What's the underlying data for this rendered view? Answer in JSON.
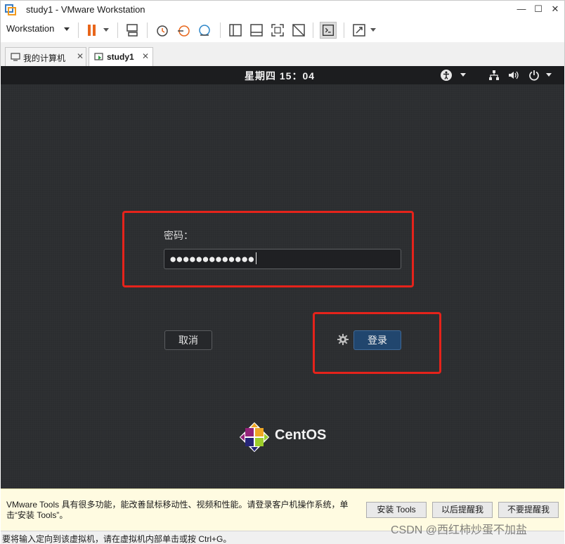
{
  "window": {
    "title": "study1 - VMware Workstation",
    "minimize_glyph": "—",
    "maximize_glyph": "☐",
    "close_glyph": "✕"
  },
  "toolbar": {
    "workstation_menu": "Workstation",
    "icons": [
      "pause-icon",
      "send-ctrl-alt-del-icon",
      "snapshot-icon",
      "revert-snapshot-icon",
      "snapshot-manager-icon",
      "show-library-icon",
      "thumbnail-bar-icon",
      "full-screen-icon",
      "unity-icon",
      "console-view-icon",
      "stretch-guest-icon"
    ]
  },
  "tabs": [
    {
      "label": "我的计算机",
      "active": false
    },
    {
      "label": "study1",
      "active": true
    }
  ],
  "tab_close_glyph": "✕",
  "vm": {
    "clock": "星期四 15：04",
    "password_label": "密码：",
    "password_value": "●●●●●●●●●●●●●",
    "cancel_button": "取消",
    "login_button": "登录",
    "brand": "CentOS",
    "colors": {
      "login_button": "#21466e",
      "highlight_box": "#e5231b",
      "background": "#2b2d30"
    }
  },
  "notification": {
    "text": "VMware Tools 具有很多功能，能改善鼠标移动性、视频和性能。请登录客户机操作系统，单击“安装 Tools”。",
    "install_button": "安装 Tools",
    "remind_later_button": "以后提醒我",
    "never_remind_button": "不要提醒我"
  },
  "statusbar": {
    "text": "要将输入定向到该虚拟机，请在虚拟机内部单击或按 Ctrl+G。"
  },
  "watermark": "CSDN @西红柿炒蛋不加盐"
}
